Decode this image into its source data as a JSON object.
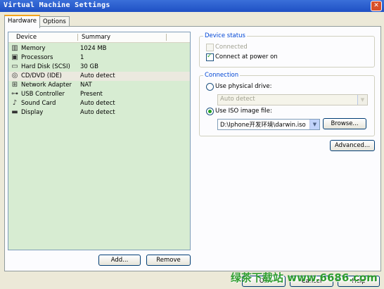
{
  "window": {
    "title": "Virtual Machine Settings",
    "close_glyph": "✕"
  },
  "tabs": [
    {
      "label": "Hardware",
      "active": true
    },
    {
      "label": "Options",
      "active": false
    }
  ],
  "device_list": {
    "headers": {
      "device": "Device",
      "summary": "Summary"
    },
    "rows": [
      {
        "icon": "memory-icon",
        "device": "Memory",
        "summary": "1024 MB",
        "selected": false
      },
      {
        "icon": "processor-icon",
        "device": "Processors",
        "summary": "1",
        "selected": false
      },
      {
        "icon": "hard-disk-icon",
        "device": "Hard Disk (SCSI)",
        "summary": "30 GB",
        "selected": false
      },
      {
        "icon": "cd-dvd-icon",
        "device": "CD/DVD (IDE)",
        "summary": "Auto detect",
        "selected": true
      },
      {
        "icon": "network-adapter-icon",
        "device": "Network Adapter",
        "summary": "NAT",
        "selected": false
      },
      {
        "icon": "usb-icon",
        "device": "USB Controller",
        "summary": "Present",
        "selected": false
      },
      {
        "icon": "sound-card-icon",
        "device": "Sound Card",
        "summary": "Auto detect",
        "selected": false
      },
      {
        "icon": "display-icon",
        "device": "Display",
        "summary": "Auto detect",
        "selected": false
      }
    ],
    "add_label": "Add...",
    "remove_label": "Remove"
  },
  "device_status": {
    "title": "Device status",
    "connected": {
      "label": "Connected",
      "checked": false,
      "enabled": false
    },
    "connect_at_power_on": {
      "label": "Connect at power on",
      "checked": true,
      "enabled": true
    }
  },
  "connection": {
    "title": "Connection",
    "use_physical_drive": {
      "label": "Use physical drive:",
      "selected": false
    },
    "physical_drive_value": "Auto detect",
    "use_iso": {
      "label": "Use ISO image file:",
      "selected": true
    },
    "iso_path": "D:\\Iphone开发环境\\darwin.iso",
    "browse_label": "Browse..."
  },
  "advanced_label": "Advanced...",
  "footer": {
    "ok_label": "OK",
    "cancel_label": "Cancel",
    "help_label": "Help"
  },
  "watermark": "绿茶下载站 www.6686.com",
  "colors": {
    "titlebar": "#1f50c4",
    "list_bg": "#d7ecd2",
    "check_green": "#21a121",
    "group_label": "#0046d5",
    "watermark": "#2f9d2f"
  }
}
